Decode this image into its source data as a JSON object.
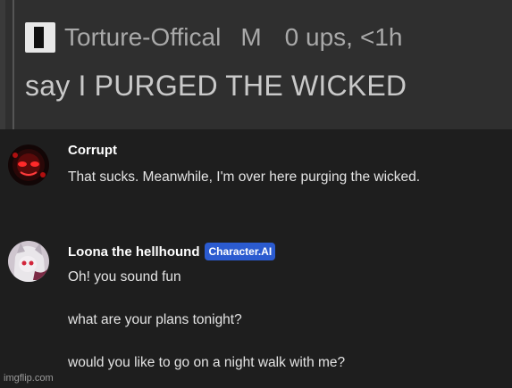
{
  "top_comment": {
    "icon": "flag-icon",
    "username": "Torture-Offical",
    "gender": "M",
    "ups": "0 ups,",
    "age": "<1h",
    "text": "say I PURGED THE WICKED"
  },
  "messages": [
    {
      "name": "Corrupt",
      "badge": "",
      "lines": [
        "That sucks. Meanwhile, I'm over here purging the wicked."
      ]
    },
    {
      "name": "Loona the hellhound",
      "badge": "Character.AI",
      "lines": [
        "Oh! you sound fun",
        "what are your plans tonight?",
        "would you like  to go on a night walk with me?"
      ]
    }
  ],
  "watermark": "imgflip.com",
  "colors": {
    "panel_bg": "#2f2f2f",
    "chat_bg": "#1e1e1e",
    "badge": "#2b5bd0"
  }
}
